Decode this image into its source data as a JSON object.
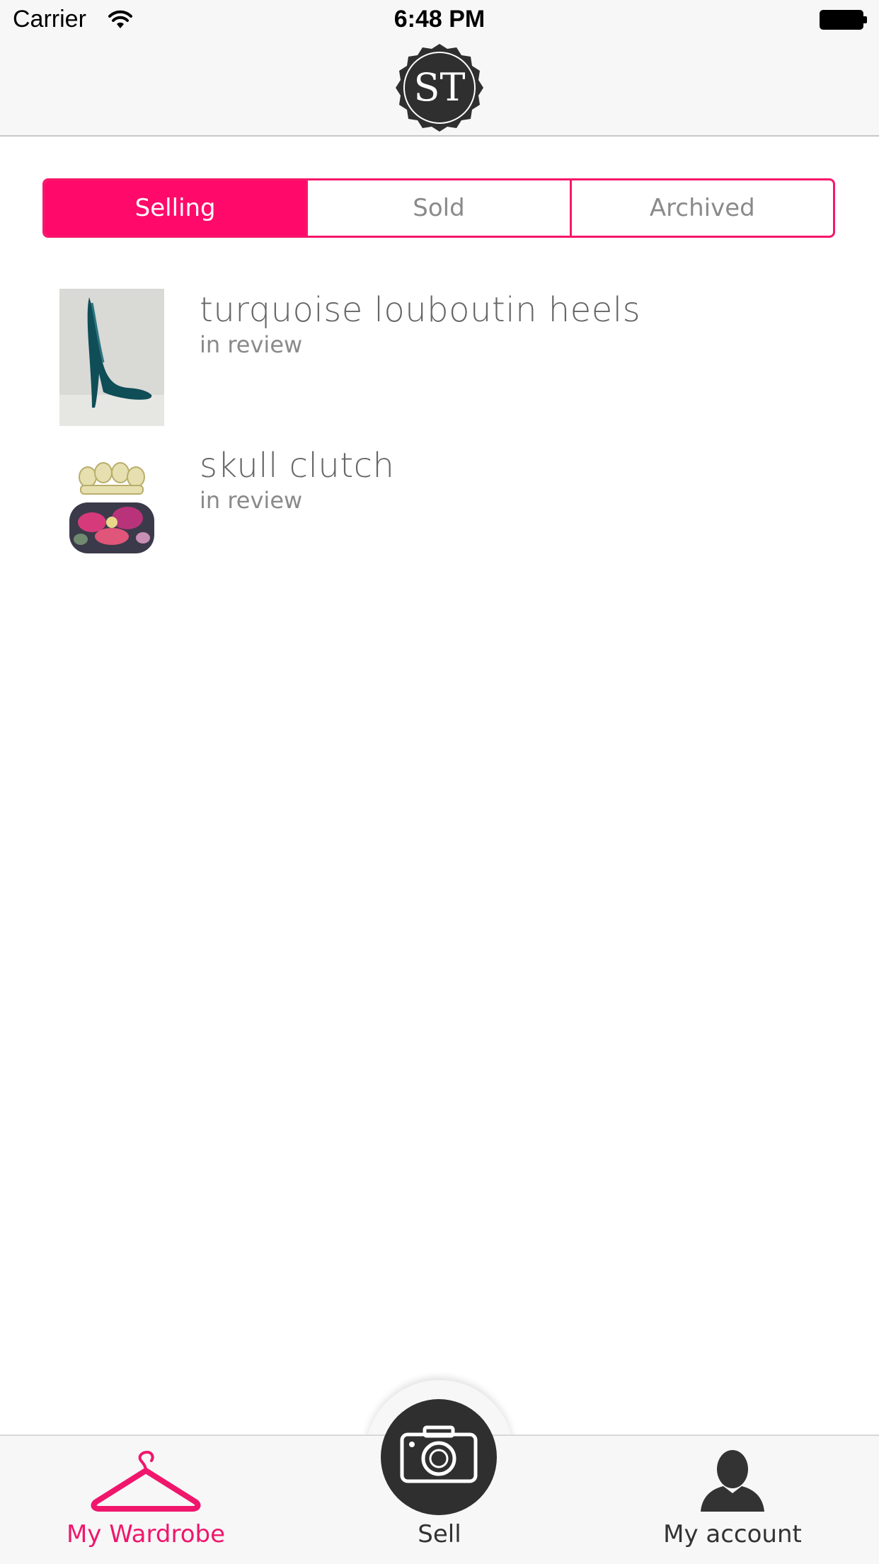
{
  "status_bar": {
    "carrier": "Carrier",
    "time": "6:48 PM"
  },
  "nav": {
    "logo_text": "ST"
  },
  "segments": [
    {
      "label": "Selling",
      "active": true
    },
    {
      "label": "Sold",
      "active": false
    },
    {
      "label": "Archived",
      "active": false
    }
  ],
  "items": [
    {
      "title": "turquoise louboutin heels",
      "status": "in review",
      "thumb_icon": "turquoise-heel-photo"
    },
    {
      "title": "skull clutch",
      "status": "in review",
      "thumb_icon": "skull-clutch-photo"
    }
  ],
  "tabs": {
    "wardrobe": {
      "label": "My Wardrobe",
      "icon": "hanger-icon"
    },
    "sell": {
      "label": "Sell",
      "icon": "camera-icon"
    },
    "account": {
      "label": "My account",
      "icon": "person-icon"
    }
  },
  "colors": {
    "accent": "#ff0a6a",
    "dark": "#2f2f2f",
    "bar": "#f7f7f7"
  }
}
